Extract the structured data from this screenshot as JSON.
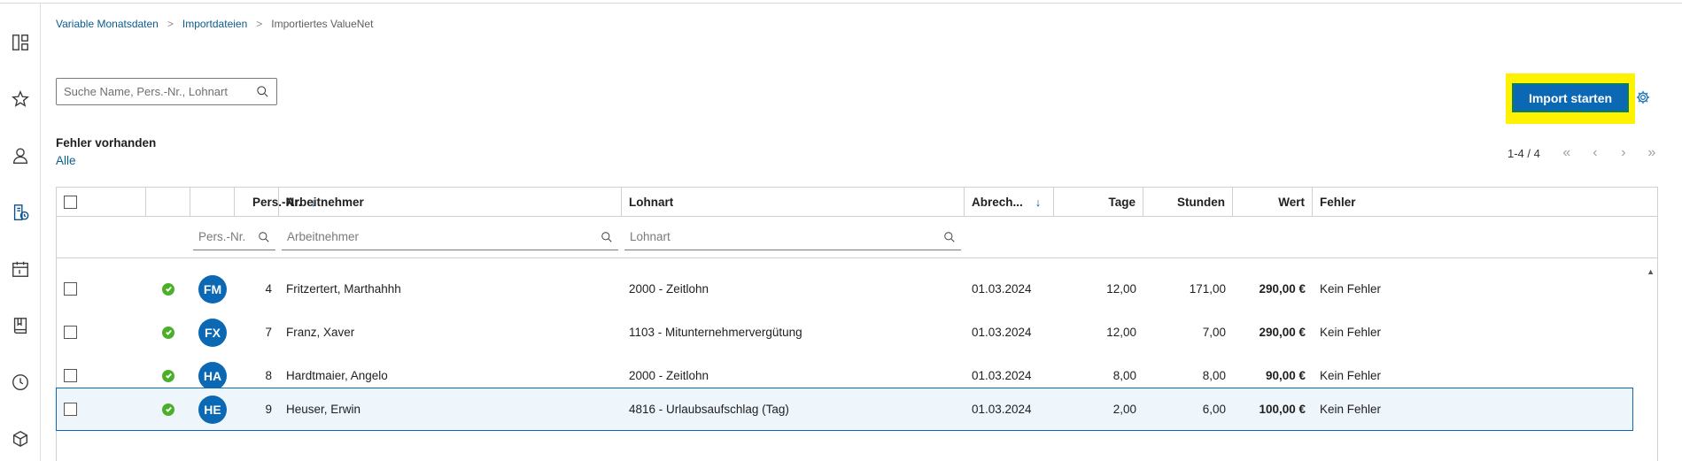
{
  "breadcrumb": {
    "items": [
      "Variable Monatsdaten",
      "Importdateien"
    ],
    "current": "Importiertes ValueNet",
    "separator": ">"
  },
  "search": {
    "placeholder": "Suche Name, Pers.-Nr., Lohnart"
  },
  "actions": {
    "import_label": "Import starten"
  },
  "filter": {
    "label": "Fehler vorhanden",
    "value": "Alle"
  },
  "pagination": {
    "range": "1-4 / 4"
  },
  "table": {
    "headers": {
      "persnr": "Pers.-Nr.",
      "arbeitnehmer": "Arbeitnehmer",
      "lohnart": "Lohnart",
      "abrech": "Abrech...",
      "tage": "Tage",
      "stunden": "Stunden",
      "wert": "Wert",
      "fehler": "Fehler"
    },
    "filter_placeholders": {
      "persnr": "Pers.-Nr.",
      "arbeitnehmer": "Arbeitnehmer",
      "lohnart": "Lohnart"
    },
    "rows": [
      {
        "initials": "FM",
        "persnr": "4",
        "name": "Fritzertert, Marthahhh",
        "lohnart": "2000 - Zeitlohn",
        "date": "01.03.2024",
        "tage": "12,00",
        "stunden": "171,00",
        "wert": "290,00 €",
        "fehler": "Kein Fehler"
      },
      {
        "initials": "FX",
        "persnr": "7",
        "name": "Franz, Xaver",
        "lohnart": "1103 - Mitunternehmervergütung",
        "date": "01.03.2024",
        "tage": "12,00",
        "stunden": "7,00",
        "wert": "290,00 €",
        "fehler": "Kein Fehler"
      },
      {
        "initials": "HA",
        "persnr": "8",
        "name": "Hardtmaier, Angelo",
        "lohnart": "2000 - Zeitlohn",
        "date": "01.03.2024",
        "tage": "8,00",
        "stunden": "8,00",
        "wert": "90,00 €",
        "fehler": "Kein Fehler"
      },
      {
        "initials": "HE",
        "persnr": "9",
        "name": "Heuser, Erwin",
        "lohnart": "4816 - Urlaubsaufschlag (Tag)",
        "date": "01.03.2024",
        "tage": "2,00",
        "stunden": "6,00",
        "wert": "100,00 €",
        "fehler": "Kein Fehler"
      }
    ]
  },
  "colors": {
    "accent": "#0a68b4",
    "link": "#0a5c8f",
    "success": "#4caf2a",
    "highlight": "#fff200"
  },
  "sidebar_icons": [
    "dashboard-icon",
    "star-icon",
    "person-icon",
    "document-clock-icon",
    "calendar-icon",
    "book-icon",
    "clock-icon",
    "box-icon"
  ]
}
